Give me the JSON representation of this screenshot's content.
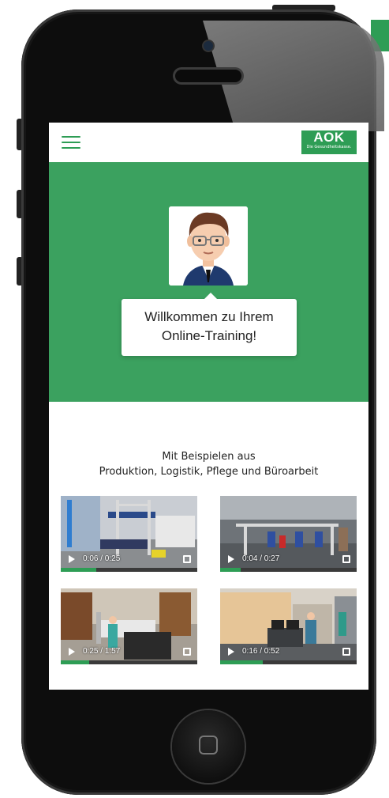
{
  "app": {
    "logo_text": "AOK",
    "logo_subtext": "Die Gesundheitskasse."
  },
  "colors": {
    "brand_green": "#3ba15f",
    "accent_green": "#2e9d55",
    "phone_black": "#0d0d0d"
  },
  "header": {
    "menu_icon": "hamburger-icon"
  },
  "hero": {
    "line1": "Willkommen zu Ihrem",
    "line2": "Online-Training!"
  },
  "intro": {
    "line1": "Mit Beispielen aus",
    "line2": "Produktion, Logistik, Pflege und Büroarbeit"
  },
  "videos": [
    {
      "time": "0:06 / 0:25",
      "progress": 0.24
    },
    {
      "time": "0:04 / 0:27",
      "progress": 0.15
    },
    {
      "time": "0:25 / 1:57",
      "progress": 0.21
    },
    {
      "time": "0:16 / 0:52",
      "progress": 0.31
    }
  ]
}
